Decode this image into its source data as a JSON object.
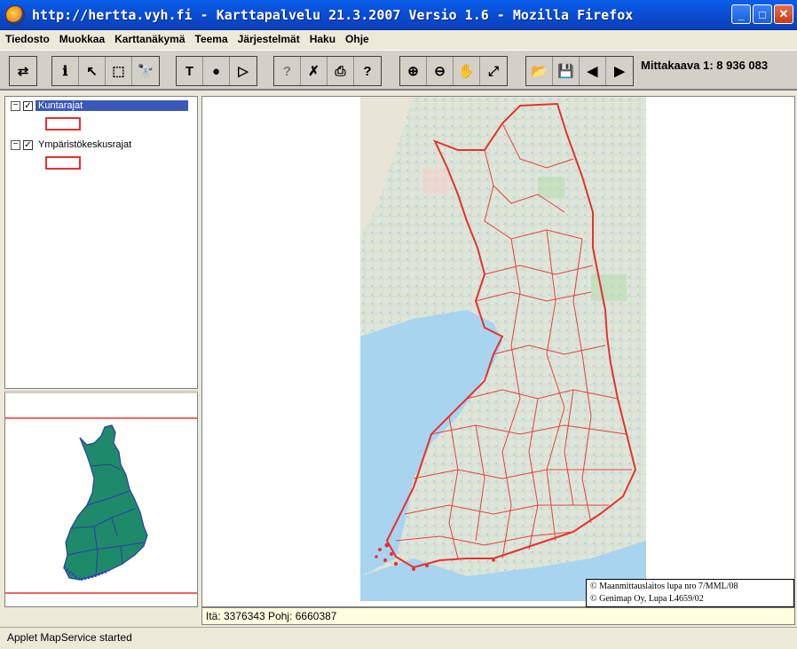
{
  "window": {
    "title": "http://hertta.vyh.fi - Karttapalvelu 21.3.2007 Versio 1.6 - Mozilla Firefox",
    "buttons": {
      "minimize": "_",
      "maximize": "□",
      "close": "✕"
    }
  },
  "menu": {
    "items": [
      "Tiedosto",
      "Muokkaa",
      "Karttanäkymä",
      "Teema",
      "Järjestelmät",
      "Haku",
      "Ohje"
    ]
  },
  "toolbar": {
    "refresh": "⇄",
    "info": "ℹ",
    "select": "↖",
    "select_box": "⬚",
    "find": "🔭",
    "text": "T",
    "point": "●",
    "arrow": "▷",
    "help_dim": "?",
    "clear": "✗",
    "print": "⎙",
    "report": "?",
    "zoom_in": "⊕",
    "zoom_out": "⊖",
    "pan": "✋",
    "full_extent": "⤢",
    "open": "📂",
    "save": "💾",
    "prev": "◀",
    "next": "▶",
    "scale_label": "Mittakaava 1: 8 936 083"
  },
  "layers": [
    {
      "name": "Kuntarajat",
      "checked": "✓",
      "collapse": "−",
      "selected": true
    },
    {
      "name": "Ympäristökeskusrajat",
      "checked": "✓",
      "collapse": "−",
      "selected": false
    }
  ],
  "map": {
    "copyright_line1": "© Maanmittauslaitos lupa nro 7/MML/08",
    "copyright_line2": "© Genimap Oy, Lupa L4659/02"
  },
  "coords": "Itä: 3376343 Pohj: 6660387",
  "status": "Applet MapService started",
  "colors": {
    "border_red": "#e83030",
    "selected_bg": "#3a58b8",
    "overview_fill": "#1f8a6a"
  }
}
